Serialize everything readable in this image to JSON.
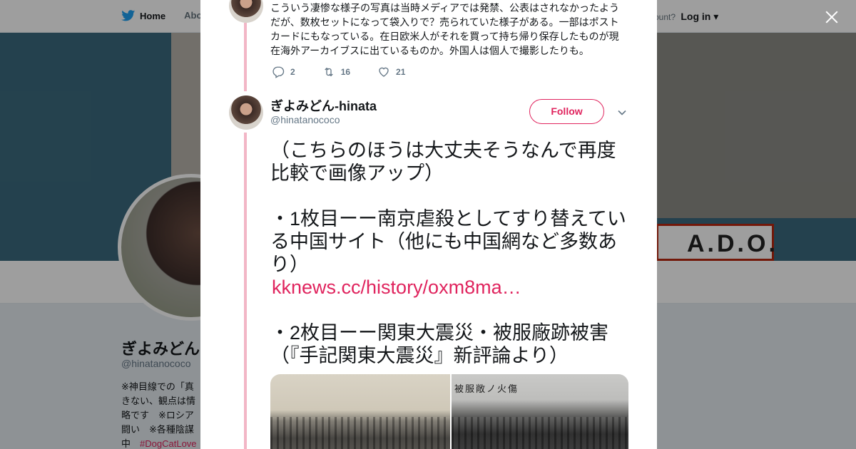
{
  "background": {
    "nav": {
      "home_label": "Home",
      "about_label": "Abo"
    },
    "account": {
      "prompt": "ccount?",
      "login_label": "Log in"
    },
    "banner_sign": "A.D.O.",
    "profile": {
      "name": "ぎよみどん",
      "handle": "@hinatanococo",
      "bio_lines": [
        "※神目線での「真",
        "きない、観点は情",
        "略です　※ロシア",
        "闘い　※各種陰謀",
        "中"
      ],
      "bio_tag": "#DogCatLove"
    }
  },
  "previous_tweet": {
    "text": "こういう凄惨な様子の写真は当時メディアでは発禁、公表はされなかったようだが、数枚セットになって袋入りで？売られていた様子がある。一部はポストカードにもなっている。在日欧米人がそれを買って持ち帰り保存したものが現在海外アーカイブスに出ているものか。外国人は個人で撮影したりも。",
    "replies": "2",
    "retweets": "16",
    "likes": "21"
  },
  "tweet": {
    "name": "ぎよみどん-hinata",
    "handle": "@hinatanococo",
    "follow_label": "Follow",
    "line1": "（こちらのほうは大丈夫そうなんで再度比較で画像アップ）",
    "line2": "・1枚目ーー南京虐殺としてすり替えている中国サイト（他にも中国網など多数あり）",
    "link": "kknews.cc/history/oxm8ma…",
    "line3": "・2枚目ーー関東大震災・被服廠跡被害（『手記関東大震災』新評論より）",
    "photo2_caption": "被服敞ノ火傷"
  },
  "colors": {
    "accent": "#e0245e",
    "thread_line": "#f2b6c6",
    "twitter_blue": "#1da1f2"
  }
}
